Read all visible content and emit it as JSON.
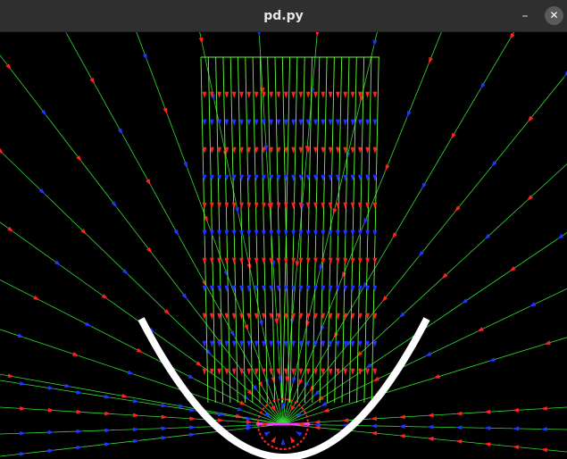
{
  "window": {
    "title": "pd.py",
    "minimize_glyph": "–",
    "close_glyph": "✕"
  },
  "colors": {
    "titlebar": "#2f2f2f",
    "background": "#000000",
    "grid": "#66ff33",
    "ray": "#33dd33",
    "marker_red": "#ff2222",
    "marker_blue": "#2233ff",
    "mirror": "#ffffff",
    "focus": "#ff33ff"
  },
  "icons": [
    "minimize-icon",
    "close-icon"
  ]
}
